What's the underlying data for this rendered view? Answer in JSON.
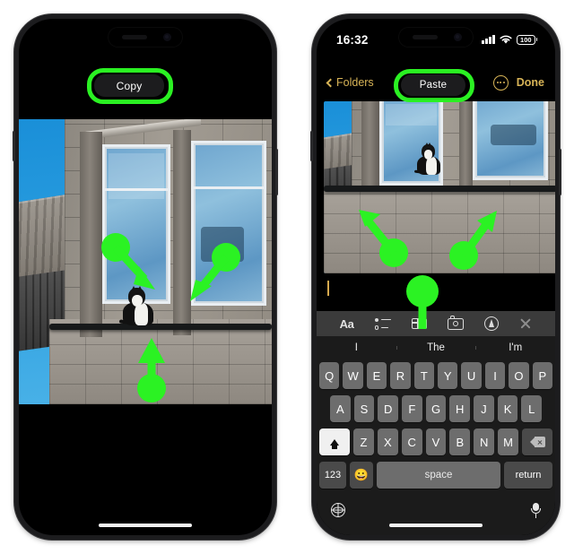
{
  "left_phone": {
    "name": "iphone-copy-step",
    "action_pill": {
      "label": "Copy",
      "highlight_color": "#2bf223"
    },
    "photo": {
      "alt": "Black and white cat sitting on a window ledge of a stone building with blue sky",
      "annotations": [
        {
          "id": "arrow-top-left",
          "direction": "down-right",
          "target": "window-left"
        },
        {
          "id": "arrow-top-right",
          "direction": "down-left",
          "target": "window-right"
        },
        {
          "id": "arrow-bottom",
          "direction": "up",
          "target": "cat-ledge"
        }
      ]
    }
  },
  "right_phone": {
    "name": "iphone-paste-step",
    "status_bar": {
      "time": "16:32",
      "cellular_icon": "signal-bars-icon",
      "wifi_icon": "wifi-icon",
      "battery_level": "100",
      "battery_icon": "battery-icon"
    },
    "nav_bar": {
      "back_icon": "chevron-left-icon",
      "back_label": "Folders",
      "more_icon": "more-options-icon",
      "done_label": "Done"
    },
    "action_pill": {
      "label": "Paste",
      "highlight_color": "#2bf223"
    },
    "photo": {
      "alt": "Pasted photo of a black and white cat on a window ledge",
      "annotations": [
        {
          "id": "arrow-left",
          "direction": "up-left",
          "target": "pasted-image"
        },
        {
          "id": "arrow-right",
          "direction": "up-right",
          "target": "pasted-image"
        },
        {
          "id": "arrow-center",
          "direction": "up",
          "target": "paste-pill"
        }
      ]
    },
    "note": {
      "caret_color": "#d6a94e",
      "text": ""
    },
    "keyboard": {
      "toolbar": [
        {
          "id": "format-icon",
          "label": "Aa"
        },
        {
          "id": "checklist-icon",
          "label": ""
        },
        {
          "id": "table-icon",
          "label": ""
        },
        {
          "id": "camera-icon",
          "label": ""
        },
        {
          "id": "markup-icon",
          "label": ""
        },
        {
          "id": "close-icon",
          "label": ""
        }
      ],
      "predictions": [
        "I",
        "The",
        "I'm"
      ],
      "row1": [
        "Q",
        "W",
        "E",
        "R",
        "T",
        "Y",
        "U",
        "I",
        "O",
        "P"
      ],
      "row2": [
        "A",
        "S",
        "D",
        "F",
        "G",
        "H",
        "J",
        "K",
        "L"
      ],
      "row3": [
        "Z",
        "X",
        "C",
        "V",
        "B",
        "N",
        "M"
      ],
      "shift_key": {
        "label": "",
        "icon": "shift-icon",
        "active": true
      },
      "backspace_key": {
        "label": "",
        "icon": "backspace-icon"
      },
      "numbers_key": "123",
      "emoji_key": "😀",
      "space_key": "space",
      "return_key": "return",
      "globe_icon": "globe-icon",
      "dictation_icon": "microphone-icon"
    }
  }
}
